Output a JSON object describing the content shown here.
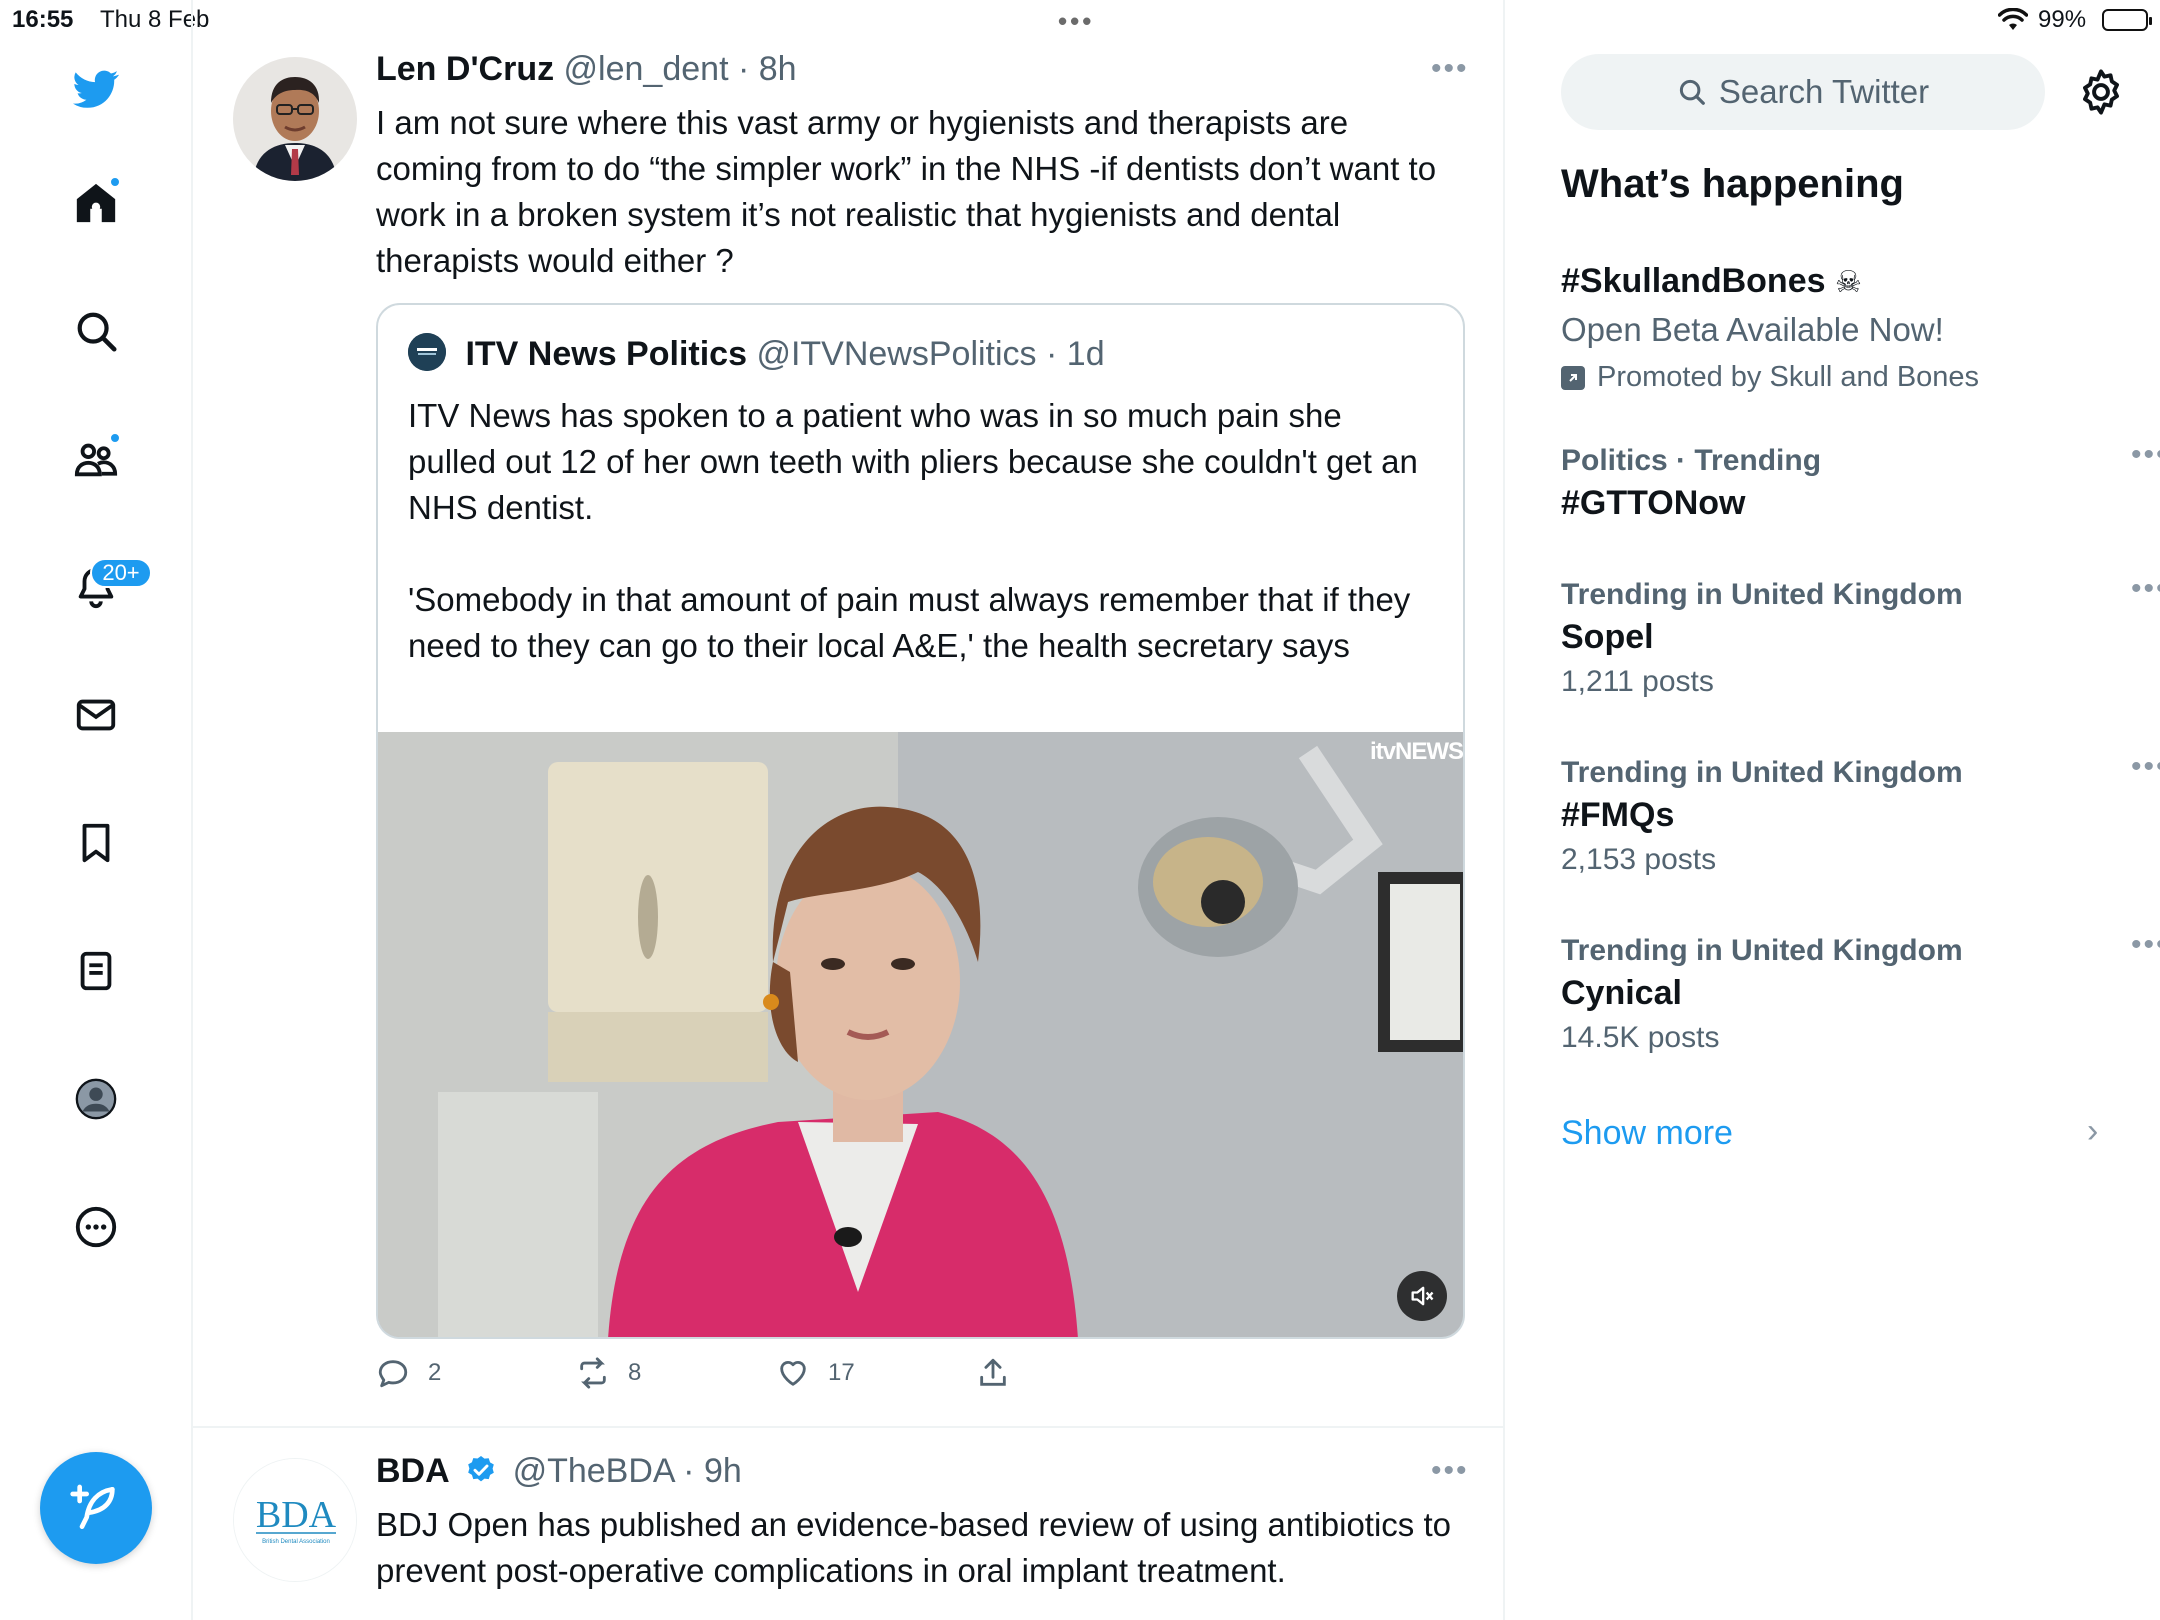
{
  "status_bar": {
    "time": "16:55",
    "date": "Thu 8 Feb",
    "battery_percent": "99%",
    "battery_level": 0.99
  },
  "nav": {
    "notifications_badge": "20+",
    "items": [
      "home-icon",
      "explore-icon",
      "communities-icon",
      "notifications-icon",
      "messages-icon",
      "bookmarks-icon",
      "lists-icon",
      "profile-icon",
      "more-icon"
    ]
  },
  "tweets": [
    {
      "name": "Len D'Cruz",
      "handle": "@len_dent",
      "time": "· 8h",
      "text": "I am not sure where this vast army or hygienists and therapists are coming from to do “the simpler work” in the NHS -if dentists don’t want to work in a broken system it’s not realistic that hygienists and dental therapists would either ?",
      "quote": {
        "name": "ITV News Politics",
        "handle": "@ITVNewsPolitics",
        "time": "· 1d",
        "text": "ITV News has spoken to a patient who was in so much pain she pulled out 12 of her own teeth with pliers because she couldn't get an NHS dentist.\n\n'Somebody in that amount of pain must always remember that if they need to they can go to their local A&E,' the health secretary says",
        "media_logo": "itvNEWS"
      },
      "replies": "2",
      "retweets": "8",
      "likes": "17"
    },
    {
      "name": "BDA",
      "handle": "@TheBDA",
      "time": "· 9h",
      "avatar_text": "BDA",
      "avatar_subtext": "British Dental Association",
      "text": "BDJ Open has published an evidence-based review of using antibiotics to prevent post-operative complications in oral implant treatment."
    }
  ],
  "sidebar": {
    "search_placeholder": "Search Twitter",
    "heading": "What’s happening",
    "promoted": {
      "title": "#SkullandBones",
      "description": "Open Beta Available Now!",
      "promoted_by": "Promoted by Skull and Bones"
    },
    "trends": [
      {
        "meta": "Politics · Trending",
        "title": "#GTTONow",
        "posts": ""
      },
      {
        "meta": "Trending in United Kingdom",
        "title": "Sopel",
        "posts": "1,211 posts"
      },
      {
        "meta": "Trending in United Kingdom",
        "title": "#FMQs",
        "posts": "2,153 posts"
      },
      {
        "meta": "Trending in United Kingdom",
        "title": "Cynical",
        "posts": "14.5K posts"
      }
    ],
    "show_more": "Show more"
  },
  "colors": {
    "accent": "#1d9bf0",
    "text": "#0f1419",
    "secondary_text": "#536471",
    "divider": "#eff3f4"
  }
}
